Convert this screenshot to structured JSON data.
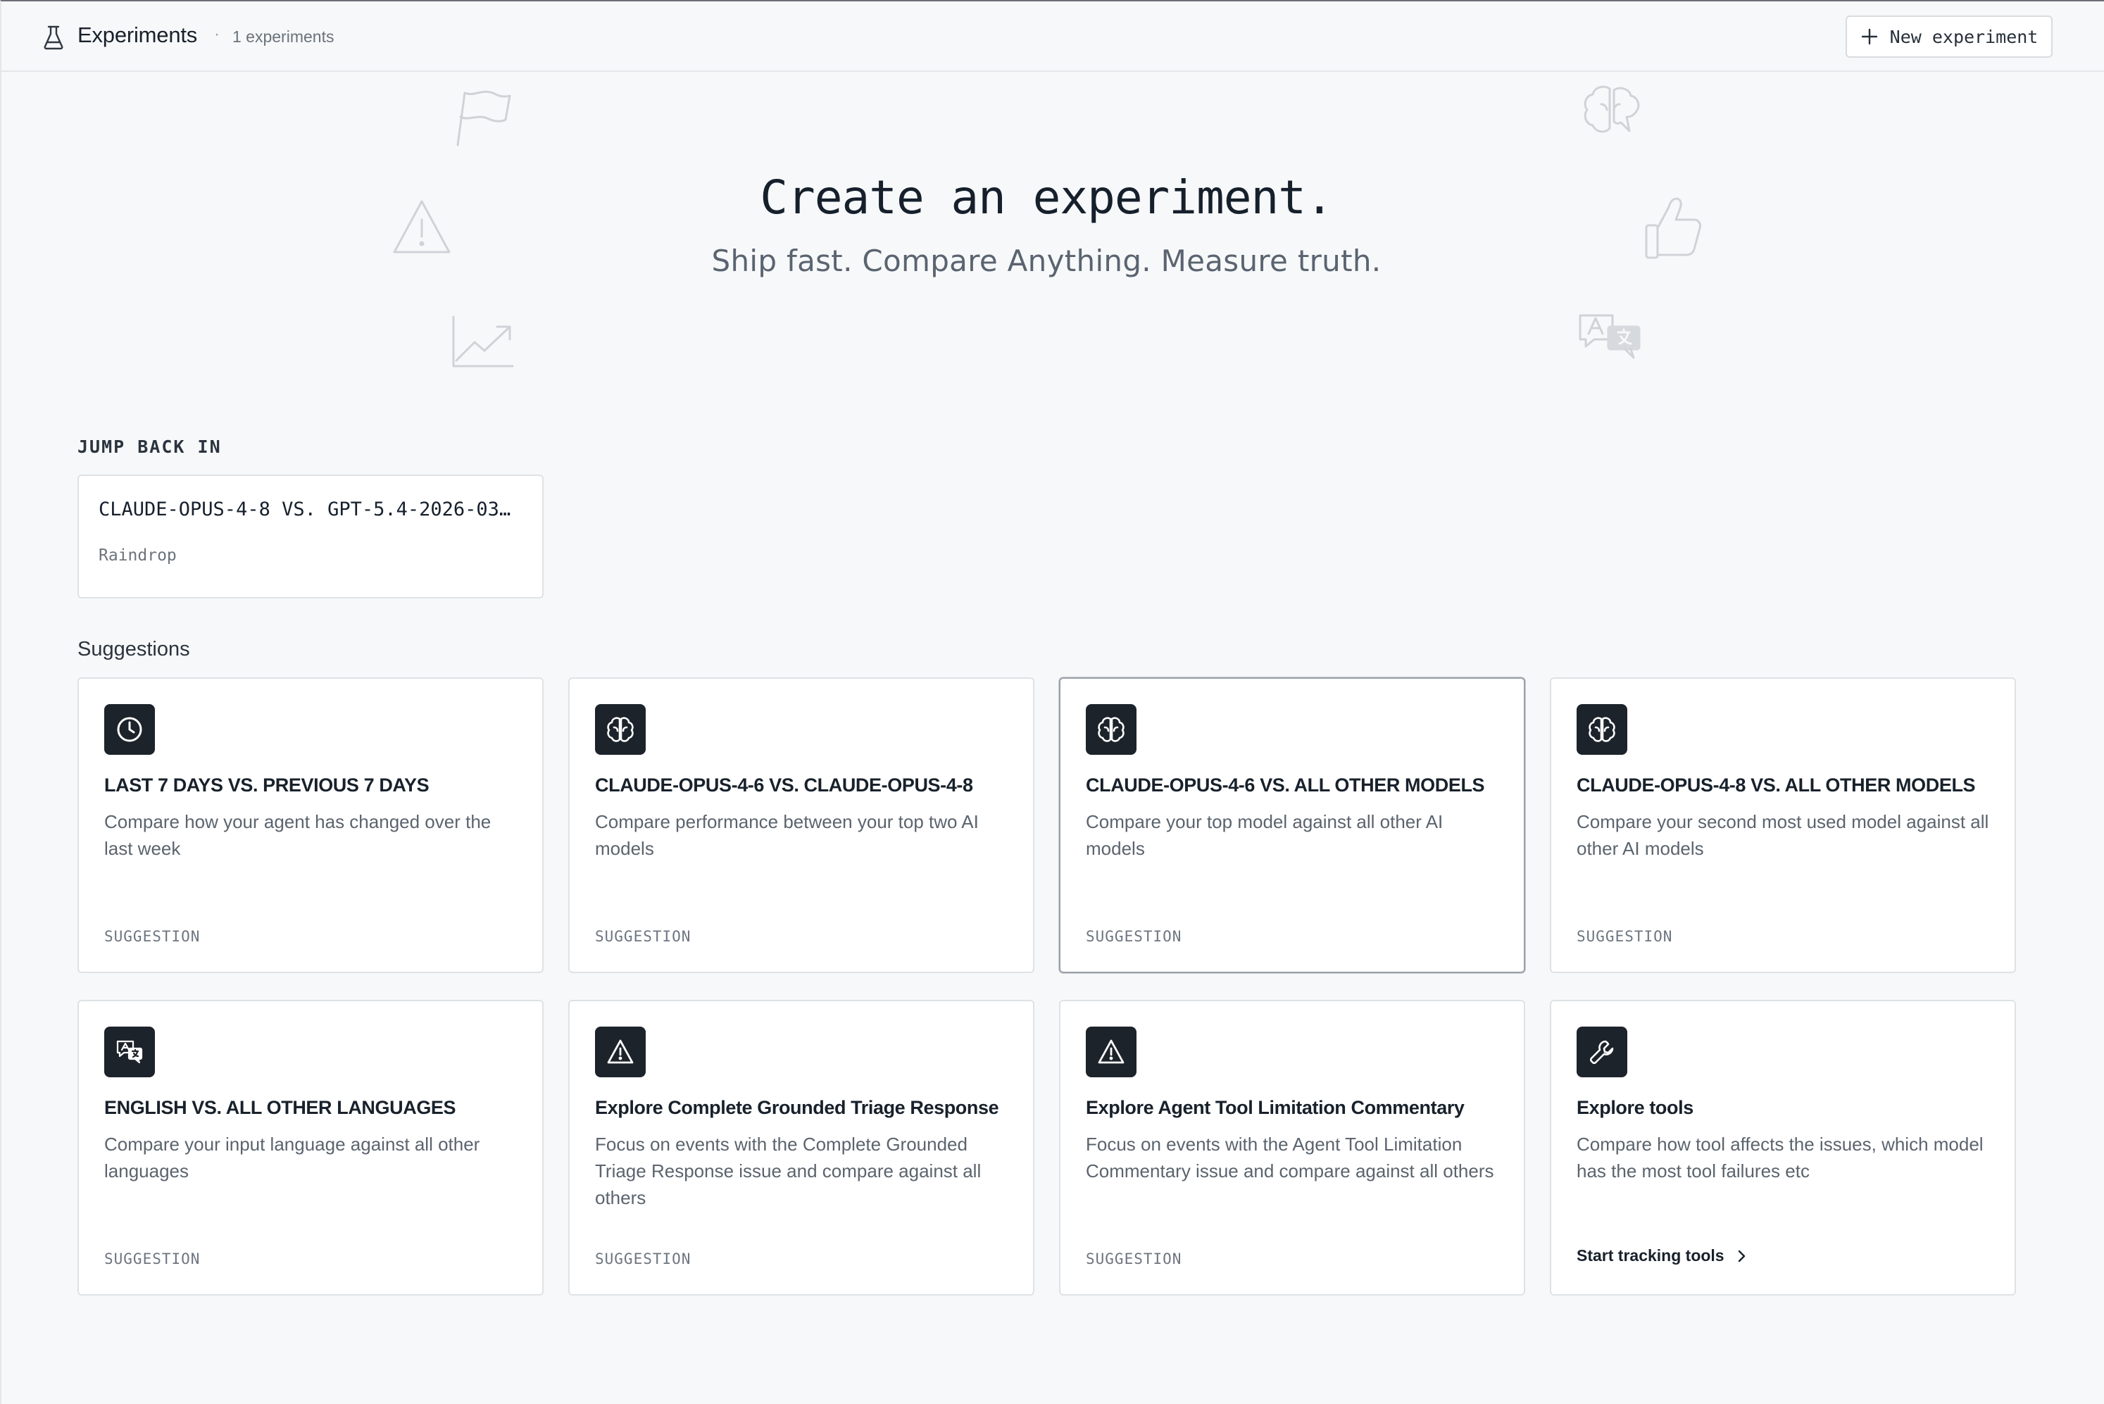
{
  "header": {
    "title": "Experiments",
    "separator": "·",
    "count": "1 experiments",
    "new_button": "New experiment",
    "icon": "flask-icon"
  },
  "hero": {
    "title": "Create an experiment.",
    "subtitle": "Ship fast. Compare Anything. Measure truth.",
    "decorative_icons": [
      "flag-icon",
      "warning-icon",
      "trend-chart-icon",
      "brain-icon",
      "thumbs-up-icon",
      "translate-icon"
    ]
  },
  "jump_back": {
    "label": "JUMP BACK IN",
    "items": [
      {
        "title": "CLAUDE-OPUS-4-8 VS. GPT-5.4-2026-03…",
        "subtitle": "Raindrop"
      }
    ]
  },
  "suggestions": {
    "label": "Suggestions",
    "cards": [
      {
        "icon": "clock-icon",
        "title": "LAST 7 DAYS VS. PREVIOUS 7 DAYS",
        "description": "Compare how your agent has changed over the last week",
        "footer": "SUGGESTION"
      },
      {
        "icon": "brain-icon",
        "title": "CLAUDE-OPUS-4-6 VS. CLAUDE-OPUS-4-8",
        "description": "Compare performance between your top two AI models",
        "footer": "SUGGESTION"
      },
      {
        "icon": "brain-icon",
        "title": "CLAUDE-OPUS-4-6 VS. ALL OTHER MODELS",
        "description": "Compare your top model against all other AI models",
        "footer": "SUGGESTION"
      },
      {
        "icon": "brain-icon",
        "title": "CLAUDE-OPUS-4-8 VS. ALL OTHER MODELS",
        "description": "Compare your second most used model against all other AI models",
        "footer": "SUGGESTION"
      },
      {
        "icon": "translate-icon",
        "title": "ENGLISH VS. ALL OTHER LANGUAGES",
        "description": "Compare your input language against all other languages",
        "footer": "SUGGESTION"
      },
      {
        "icon": "warning-icon",
        "title": "Explore Complete Grounded Triage Response",
        "description": "Focus on events with the Complete Grounded Triage Response issue and compare against all others",
        "footer": "SUGGESTION"
      },
      {
        "icon": "warning-icon",
        "title": "Explore Agent Tool Limitation Commentary",
        "description": "Focus on events with the Agent Tool Limitation Commentary issue and compare against all others",
        "footer": "SUGGESTION"
      },
      {
        "icon": "wrench-icon",
        "title": "Explore tools",
        "description": "Compare how tool affects the issues, which model has the most tool failures etc",
        "link": "Start tracking tools"
      }
    ]
  },
  "colors": {
    "background": "#f7f8f9",
    "card": "#ffffff",
    "icon_tile": "#1d232b",
    "border": "#dfe2e5",
    "text": "#18212b",
    "muted": "#5b646e"
  }
}
